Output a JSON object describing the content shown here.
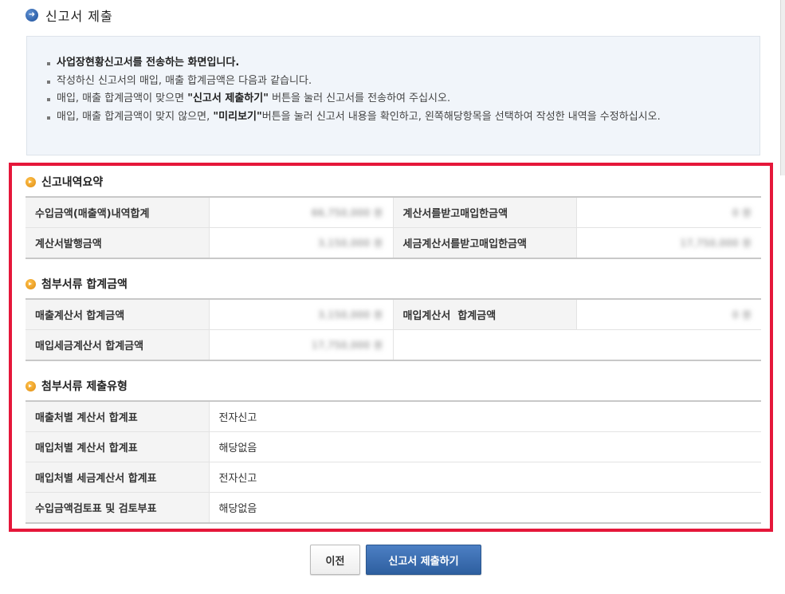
{
  "page": {
    "title": "신고서 제출"
  },
  "info": {
    "lines": [
      "사업장현황신고서를 전송하는 화면입니다.",
      "작성하신 신고서의 매입, 매출 합계금액은 다음과 같습니다.",
      "매입, 매출 합계금액이 맞으면 \"신고서 제출하기\" 버튼을 눌러 신고서를 전송하여 주십시오.",
      "매입, 매출 합계금액이 맞지 않으면, \"미리보기\"버튼을 눌러 신고서 내용을 확인하고, 왼쪽해당항목을 선택하여 작성한 내역을 수정하십시오."
    ],
    "line3": {
      "pre": "매입, 매출 합계금액이 맞으면 ",
      "bold": "\"신고서 제출하기\"",
      "post": " 버튼을 눌러 신고서를 전송하여 주십시오."
    },
    "line4": {
      "pre": "매입, 매출 합계금액이 맞지 않으면, ",
      "bold": "\"미리보기\"",
      "post": "버튼을 눌러 신고서 내용을 확인하고, 왼쪽해당항목을 선택하여 작성한 내역을 수정하십시오."
    }
  },
  "summary": {
    "title": "신고내역요약",
    "rows": [
      {
        "label1": "수입금액(매출액)내역합계",
        "value1": "66,750,000 원",
        "label2": "계산서를받고매입한금액",
        "value2": "0 원"
      },
      {
        "label1": "계산서발행금액",
        "value1": "3,150,000 원",
        "label2": "세금계산서를받고매입한금액",
        "value2": "17,750,000 원"
      }
    ]
  },
  "attach_totals": {
    "title": "첨부서류 합계금액",
    "rows": [
      {
        "label1": "매출계산서 합계금액",
        "value1": "3,150,000 원",
        "label2": "매입계산서  합계금액",
        "value2": "0 원"
      },
      {
        "label1": "매입세금계산서 합계금액",
        "value1": "17,750,000 원"
      }
    ]
  },
  "attach_types": {
    "title": "첨부서류 제출유형",
    "rows": [
      {
        "label": "매출처별 계산서 합계표",
        "value": "전자신고"
      },
      {
        "label": "매입처별 계산서 합계표",
        "value": "해당없음"
      },
      {
        "label": "매입처별 세금계산서 합계표",
        "value": "전자신고"
      },
      {
        "label": "수입금액검토표 및 검토부표",
        "value": "해당없음"
      }
    ]
  },
  "buttons": {
    "prev": "이전",
    "submit": "신고서 제출하기"
  },
  "colors": {
    "highlight": "#e5173a",
    "submit_button": "#3a6cb0"
  },
  "icons": {
    "title": "circle-arrow-right-icon",
    "section": "orange-bullet-icon"
  }
}
